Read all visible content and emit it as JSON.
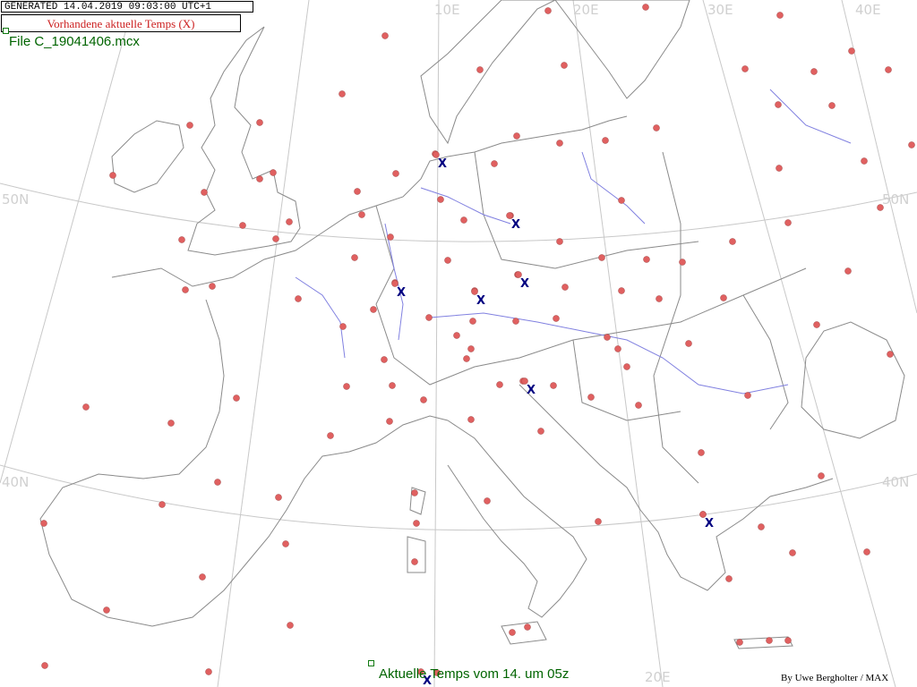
{
  "header": {
    "generated": "GENERATED 14.04.2019 09:03:00 UTC+1",
    "legend": "Vorhandene aktuelle Temps (X)"
  },
  "file_label": "File C_19041406.mcx",
  "bottom_title": "Aktuelle Temps vom 14. um 05z",
  "credit": "By Uwe Bergholter / MAX",
  "grid_labels": {
    "lon_top": [
      "10E",
      "20E",
      "30E",
      "40E"
    ],
    "lon_bottom": [
      "20E"
    ],
    "lat_left": [
      "50N",
      "40N"
    ],
    "lat_right": [
      "50N",
      "40N"
    ]
  },
  "colors": {
    "station_dot": "#e06060",
    "station_marker": "#000080",
    "coastline": "#8a8a8a",
    "river": "#8080e0",
    "graticule": "#c8c8c8",
    "label_green": "#006400",
    "legend_red": "#cc2020"
  },
  "map_data": {
    "projection": "Lambert conic (Europe)",
    "stations_total": 172,
    "stations_with_current_temp": 8,
    "marker_symbol": "X"
  }
}
